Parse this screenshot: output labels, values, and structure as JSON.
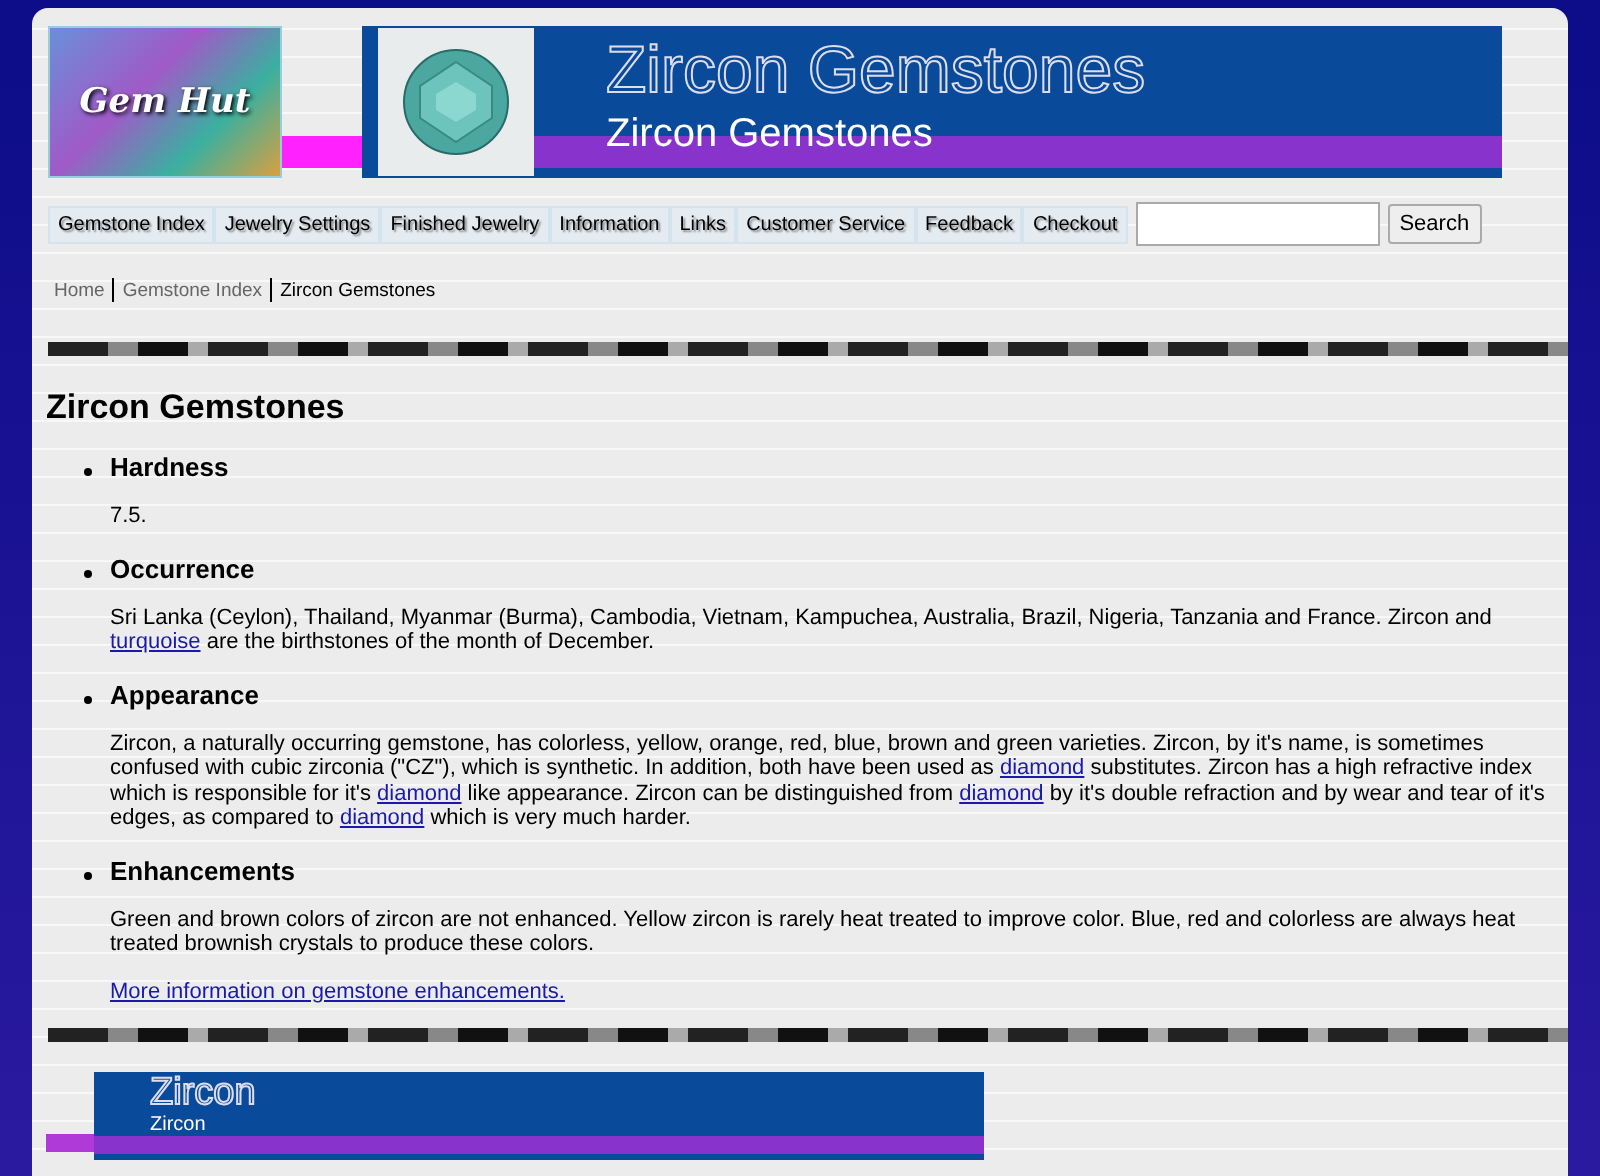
{
  "header": {
    "logo_text": "Gem Hut",
    "banner_outline_title": "Zircon Gemstones",
    "banner_title": "Zircon Gemstones"
  },
  "nav": {
    "items": [
      {
        "label": "Gemstone Index"
      },
      {
        "label": "Jewelry Settings"
      },
      {
        "label": "Finished Jewelry"
      },
      {
        "label": "Information"
      },
      {
        "label": "Links"
      },
      {
        "label": "Customer Service"
      },
      {
        "label": "Feedback"
      },
      {
        "label": "Checkout"
      }
    ],
    "search_button": "Search"
  },
  "breadcrumb": [
    {
      "label": "Home",
      "current": false
    },
    {
      "label": "Gemstone Index",
      "current": false
    },
    {
      "label": "Zircon Gemstones",
      "current": true
    }
  ],
  "heading": "Zircon Gemstones",
  "sections": [
    {
      "title": "Hardness",
      "paragraphs": [
        [
          {
            "kind": "text",
            "text": "7.5."
          }
        ]
      ]
    },
    {
      "title": "Occurrence",
      "paragraphs": [
        [
          {
            "kind": "text",
            "text": "Sri Lanka (Ceylon), Thailand, Myanmar (Burma), Cambodia, Vietnam, Kampuchea, Australia, Brazil, Nigeria, Tanzania and France. Zircon and "
          },
          {
            "kind": "link",
            "text": "turquoise"
          },
          {
            "kind": "text",
            "text": " are the birthstones of the month of December."
          }
        ]
      ]
    },
    {
      "title": "Appearance",
      "paragraphs": [
        [
          {
            "kind": "text",
            "text": "Zircon, a naturally occurring gemstone, has colorless, yellow, orange, red, blue, brown and green varieties. Zircon, by it's name, is sometimes confused with cubic zirconia (\"CZ\"), which is synthetic. In addition, both have been used as "
          },
          {
            "kind": "link",
            "text": "diamond"
          },
          {
            "kind": "text",
            "text": " substitutes. Zircon has a high refractive index which is responsible for it's "
          },
          {
            "kind": "link",
            "text": "diamond"
          },
          {
            "kind": "text",
            "text": " like appearance. Zircon can be distinguished from "
          },
          {
            "kind": "link",
            "text": "diamond"
          },
          {
            "kind": "text",
            "text": " by it's double refraction and by wear and tear of it's edges, as compared to "
          },
          {
            "kind": "link",
            "text": "diamond"
          },
          {
            "kind": "text",
            "text": " which is very much harder."
          }
        ]
      ]
    },
    {
      "title": "Enhancements",
      "paragraphs": [
        [
          {
            "kind": "text",
            "text": "Green and brown colors of zircon are not enhanced. Yellow zircon is rarely heat treated to improve color. Blue, red and colorless are always heat treated brownish crystals to produce these colors."
          }
        ],
        [
          {
            "kind": "link",
            "text": "More information on gemstone enhancements."
          }
        ]
      ]
    }
  ],
  "footer_banner": {
    "outline_title": "Zircon",
    "title": "Zircon"
  }
}
